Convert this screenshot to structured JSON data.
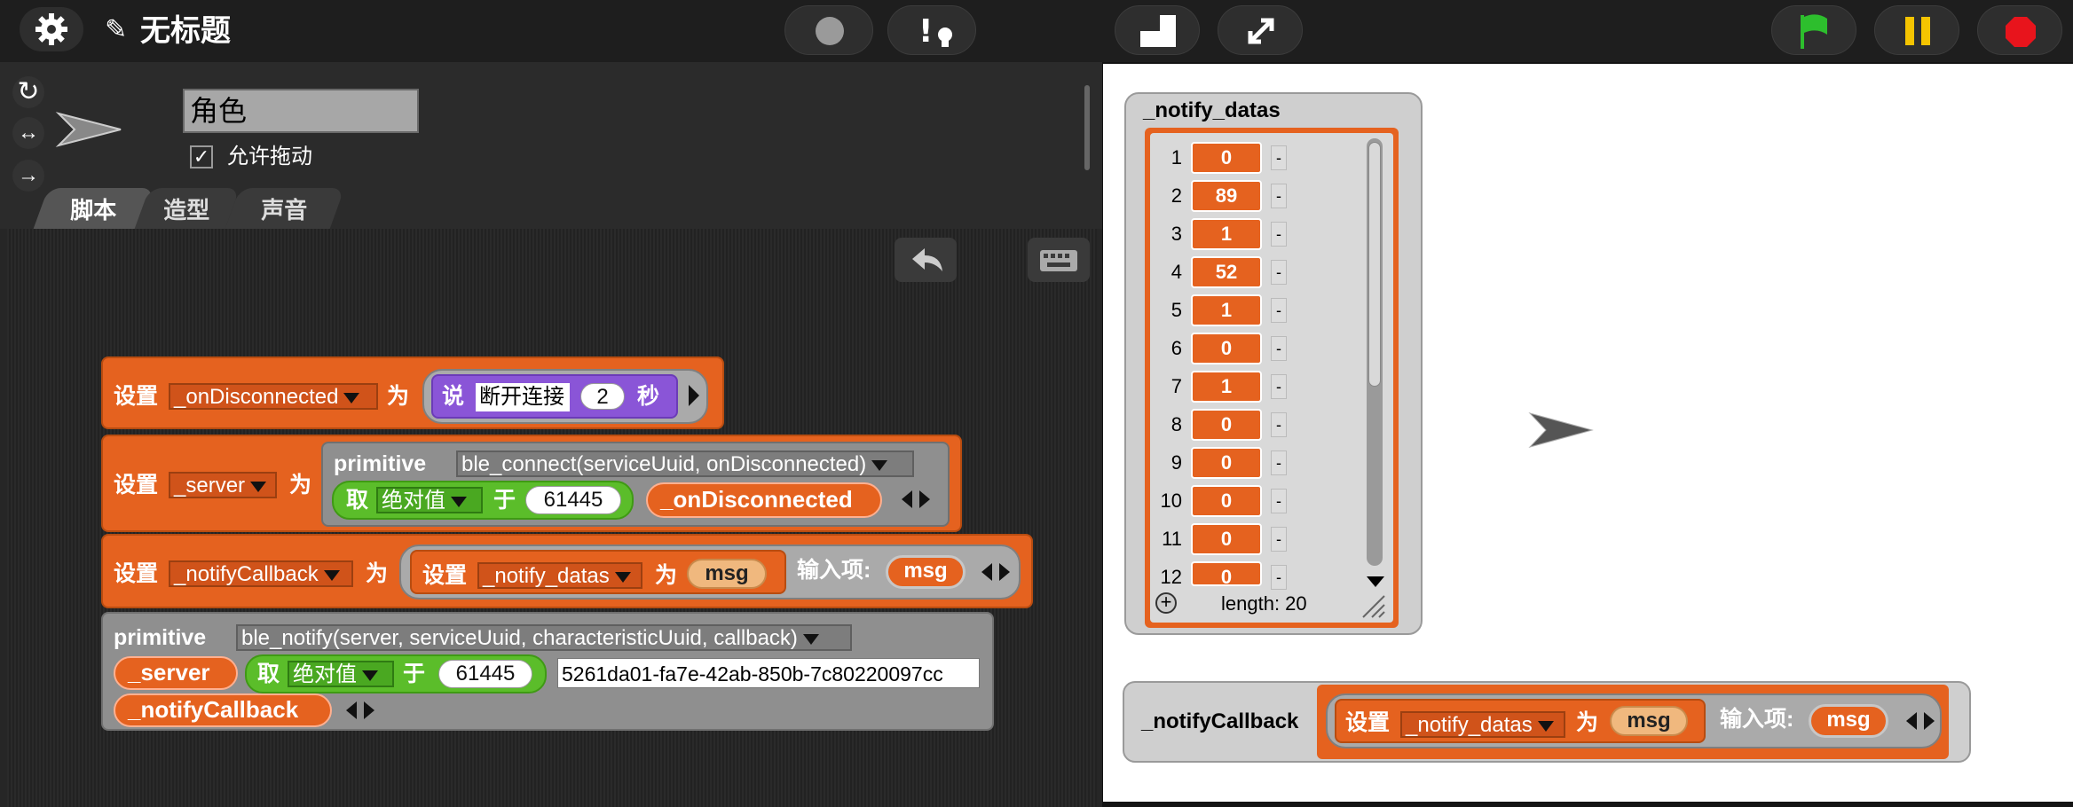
{
  "app": {
    "title": "无标题",
    "pencil_icon": "pencil-icon"
  },
  "topbar": {
    "icons": [
      "gear-icon",
      "record-circle-icon",
      "warning-icon",
      "stage-size-icon",
      "fullscreen-icon",
      "green-flag-icon",
      "pause-icon",
      "stop-icon"
    ],
    "colors": {
      "flag": "#2dbe2d",
      "pause": "#f5c400",
      "stop": "#e8141c"
    }
  },
  "sprite": {
    "name": "角色",
    "draggable_label": "允许拖动",
    "draggable_checked": true,
    "rotation_icons": [
      "rotate-full-icon",
      "rotate-left-right-icon",
      "rotate-none-icon"
    ]
  },
  "tabs": [
    {
      "label": "脚本",
      "active": true
    },
    {
      "label": "造型",
      "active": false
    },
    {
      "label": "声音",
      "active": false
    }
  ],
  "scripts": {
    "b1": {
      "set": "设置",
      "var": "_onDisconnected",
      "to": "为",
      "say": "说",
      "say_text": "断开连接",
      "secs_val": "2",
      "secs": "秒"
    },
    "b2": {
      "set": "设置",
      "var": "_server",
      "to": "为",
      "primitive": "primitive",
      "prim_fn": "ble_connect(serviceUuid, onDisconnected)",
      "take": "取",
      "fn": "绝对值",
      "of": "于",
      "num": "61445",
      "arg": "_onDisconnected"
    },
    "b3": {
      "set": "设置",
      "var": "_notifyCallback",
      "to": "为",
      "inner_set": "设置",
      "inner_var": "_notify_datas",
      "inner_to": "为",
      "inner_val": "msg",
      "input_label": "输入项:",
      "input_name": "msg"
    },
    "b4": {
      "primitive": "primitive",
      "prim_fn": "ble_notify(server, serviceUuid, characteristicUuid, callback)",
      "arg1": "_server",
      "take": "取",
      "fn": "绝对值",
      "of": "于",
      "num": "61445",
      "uuid": "5261da01-fa7e-42ab-850b-7c80220097cc",
      "arg4": "_notifyCallback"
    }
  },
  "stage": {
    "watcher_title": "_notify_datas",
    "rows": [
      {
        "idx": "1",
        "val": "0"
      },
      {
        "idx": "2",
        "val": "89"
      },
      {
        "idx": "3",
        "val": "1"
      },
      {
        "idx": "4",
        "val": "52"
      },
      {
        "idx": "5",
        "val": "1"
      },
      {
        "idx": "6",
        "val": "0"
      },
      {
        "idx": "7",
        "val": "1"
      },
      {
        "idx": "8",
        "val": "0"
      },
      {
        "idx": "9",
        "val": "0"
      },
      {
        "idx": "10",
        "val": "0"
      },
      {
        "idx": "11",
        "val": "0"
      },
      {
        "idx": "12",
        "val": "0"
      }
    ],
    "dash": "-",
    "length_label": "length: 20",
    "notify_watcher": {
      "name": "_notifyCallback",
      "set": "设置",
      "var": "_notify_datas",
      "to": "为",
      "val": "msg",
      "input_label": "输入项:",
      "input_name": "msg"
    }
  }
}
